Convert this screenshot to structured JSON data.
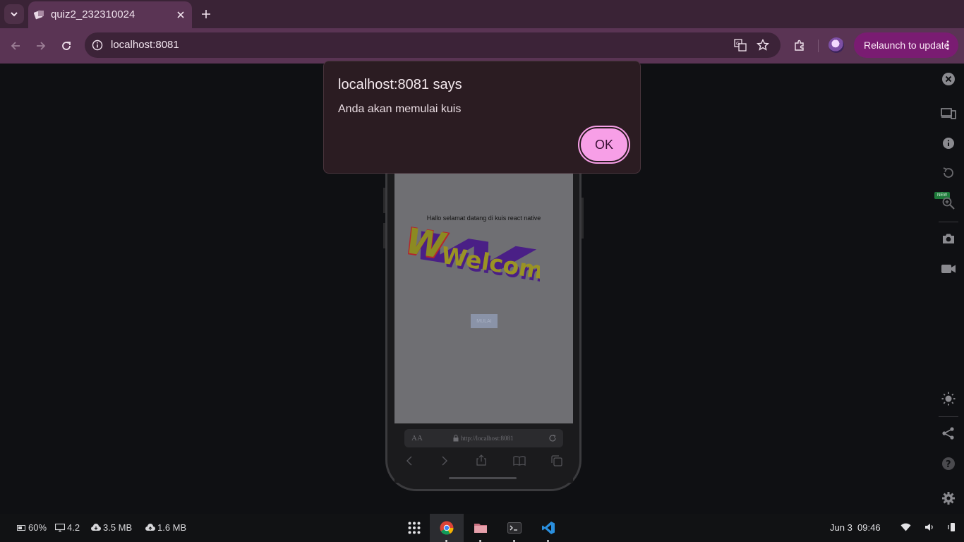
{
  "browser": {
    "tab_title": "quiz2_232310024",
    "url": "localhost:8081",
    "relaunch_label": "Relaunch to update"
  },
  "app": {
    "welcome_message": "Hallo selamat datang di kuis react native",
    "welcome_art_text": "Welcome",
    "start_button_label": "MULAI",
    "mobile_url": "http://localhost:8081",
    "aa_label": "AA"
  },
  "devtools": {
    "new_badge": "NEW"
  },
  "dialog": {
    "title": "localhost:8081 says",
    "message": "Anda akan memulai kuis",
    "ok_label": "OK"
  },
  "taskbar": {
    "battery": "60%",
    "load": "4.2",
    "download": "3.5 MB",
    "upload": "1.6 MB",
    "date": "Jun 3",
    "time": "09:46"
  }
}
